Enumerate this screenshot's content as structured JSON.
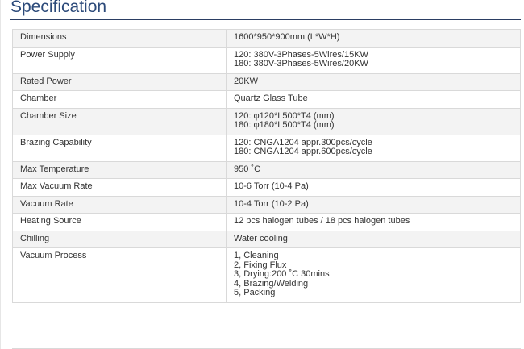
{
  "section_title": "Specification",
  "spec_table": {
    "rows": [
      {
        "label": "Dimensions",
        "values": [
          "1600*950*900mm (L*W*H)"
        ]
      },
      {
        "label": "Power Supply",
        "values": [
          "120: 380V-3Phases-5Wires/15KW",
          "180: 380V-3Phases-5Wires/20KW"
        ]
      },
      {
        "label": "Rated Power",
        "values": [
          "20KW"
        ]
      },
      {
        "label": "Chamber",
        "values": [
          "Quartz Glass Tube"
        ]
      },
      {
        "label": "Chamber Size",
        "values": [
          "120: φ120*L500*T4 (mm)",
          "180: φ180*L500*T4 (mm)"
        ]
      },
      {
        "label": "Brazing Capability",
        "values": [
          "120: CNGA1204 appr.300pcs/cycle",
          "180: CNGA1204 appr.600pcs/cycle"
        ]
      },
      {
        "label": "Max Temperature",
        "values": [
          "950 ˚C"
        ]
      },
      {
        "label": "Max Vacuum Rate",
        "values": [
          "10-6 Torr (10-4 Pa)"
        ]
      },
      {
        "label": "Vacuum Rate",
        "values": [
          "10-4 Torr (10-2 Pa)"
        ]
      },
      {
        "label": "Heating Source",
        "values": [
          "12 pcs halogen tubes / 18 pcs halogen tubes"
        ]
      },
      {
        "label": "Chilling",
        "values": [
          "Water cooling"
        ]
      },
      {
        "label": "Vacuum Process",
        "values": [
          "1, Cleaning",
          "2, Fixing Flux",
          "3, Drying:200 ˚C 30mins",
          "4, Brazing/Welding",
          "5, Packing"
        ]
      }
    ]
  },
  "colors": {
    "title": "#2c4a7a",
    "title_rule": "#2b3e63",
    "row_shade": "#f3f3f3",
    "border": "#d9d9d9",
    "text": "#333333"
  }
}
